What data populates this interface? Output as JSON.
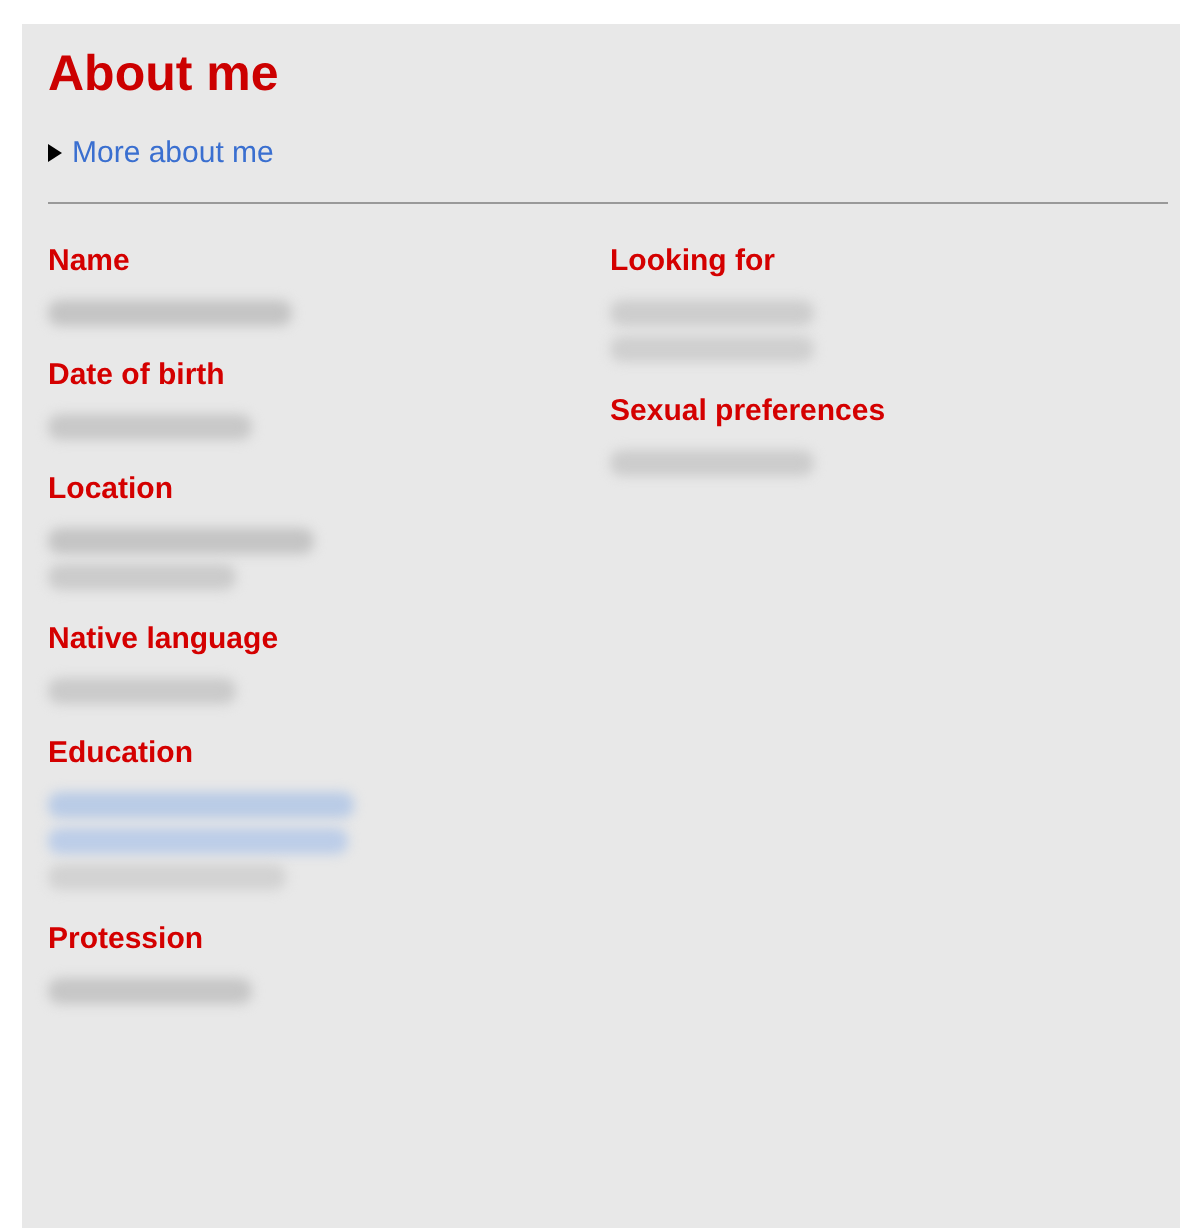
{
  "title": "About me",
  "more_link": {
    "label": "More about me",
    "expanded": false
  },
  "columns": [
    [
      {
        "label": "Name",
        "blurred_lines": [
          {
            "color": "#c4c4c4"
          }
        ]
      },
      {
        "label": "Date of birth",
        "blurred_lines": [
          {
            "color": "#c8c8c8"
          }
        ]
      },
      {
        "label": "Location",
        "blurred_lines": [
          {
            "color": "#c4c4c4"
          },
          {
            "color": "#cbcbcb"
          }
        ]
      },
      {
        "label": "Native language",
        "blurred_lines": [
          {
            "color": "#cacaca"
          }
        ]
      },
      {
        "label": "Education",
        "blurred_lines": [
          {
            "color": "#b9cbe6"
          },
          {
            "color": "#bccde8"
          },
          {
            "color": "#d2d2d2"
          }
        ]
      },
      {
        "label": "Protession",
        "blurred_lines": [
          {
            "color": "#c6c6c6"
          }
        ]
      }
    ],
    [
      {
        "label": "Looking for",
        "blurred_lines": [
          {
            "color": "#cdcdcd"
          },
          {
            "color": "#cfcfcf"
          }
        ]
      },
      {
        "label": "Sexual preferences",
        "blurred_lines": [
          {
            "color": "#cccccc"
          }
        ]
      }
    ]
  ]
}
